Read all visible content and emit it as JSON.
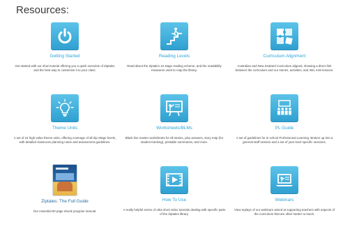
{
  "page": {
    "heading": "Resources:"
  },
  "colors": {
    "tile_gradient_top": "#5cc3e9",
    "tile_gradient_bottom": "#2e9fd0",
    "title_link": "#2aa3d6"
  },
  "resources": [
    {
      "title": "Getting Started",
      "icon": "power-icon",
      "description": "Get started with our short tutorial offering you a quick overview of Ziptales and the best way to customise it to your class."
    },
    {
      "title": "Reading Levels",
      "icon": "stairs-climber-icon",
      "description": "Read about the Ziptales 10 stage reading scheme, and the readability measures used to map the library."
    },
    {
      "title": "Curriculum Alignment",
      "icon": "puzzle-icon",
      "description": "Australian and New Zealand Curriculum aligned, showing a direct link between the curriculum and our stories, activities, and SEL mini lessons."
    },
    {
      "title": "Theme Units",
      "icon": "lightbulb-icon",
      "description": "A set of 24 high value theme units, offering coverage of all Zip Stage levels, with detailed classroom planning notes and assessment guidelines."
    },
    {
      "title": "Worksheets/BLMs",
      "icon": "teacher-board-icon",
      "description": "Black line master worksheets for all stories, plus answers, story map (for student tracking), printable summaries, and more."
    },
    {
      "title": "PL Guide",
      "icon": "classroom-icon",
      "description": "A set of guidelines for in school Professional Learning. Broken up into a general staff session and a set of year level specific sessions."
    },
    {
      "title": "Ziptales: The Full Guide",
      "icon": "ebook-cover-icon",
      "description": "Our essential 50 page ebook program manual."
    },
    {
      "title": "How To Use",
      "icon": "video-player-icon",
      "description": "A really helpful series of ultra short video tutorials dealing with specific parts of the Ziptales library."
    },
    {
      "title": "Webinars",
      "icon": "laptop-presentation-icon",
      "description": "View replays of our webinars aimed at supporting teachers with aspects of the curriculum that are often harder to teach."
    }
  ]
}
